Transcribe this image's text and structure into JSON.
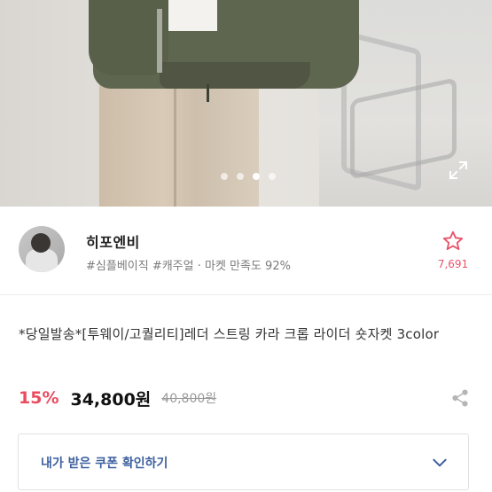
{
  "carousel": {
    "count": 4,
    "active_index": 2
  },
  "seller": {
    "name": "히포엔비",
    "tags": "#심플베이직 #캐주얼 · 마켓 만족도 92%",
    "favorite_count": "7,691"
  },
  "product": {
    "title": "*당일발송*[투웨이/고퀄리티]레더 스트링 카라 크롭 라이더 숏자켓 3color",
    "discount": "15%",
    "price": "34,800원",
    "original_price": "40,800원"
  },
  "coupon": {
    "label": "내가 받은 쿠폰 확인하기"
  },
  "colors": {
    "accent_pink": "#ea4b5f",
    "coupon_blue": "#3d5f9f"
  },
  "icons": [
    "expand-icon",
    "star-icon",
    "share-icon",
    "chevron-down-icon"
  ]
}
